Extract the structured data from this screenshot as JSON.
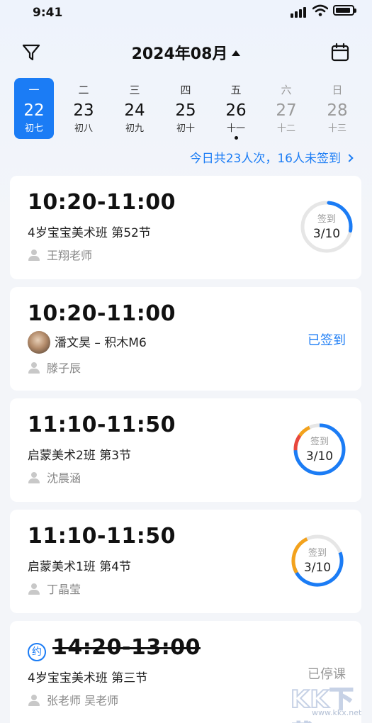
{
  "status_bar": {
    "time": "9:41"
  },
  "header": {
    "month": "2024年08月",
    "icons": {
      "filter": "filter-icon",
      "calendar": "calendar-icon"
    }
  },
  "week": [
    {
      "weekday": "一",
      "date": "22",
      "lunar": "初七",
      "selected": true
    },
    {
      "weekday": "二",
      "date": "23",
      "lunar": "初八"
    },
    {
      "weekday": "三",
      "date": "24",
      "lunar": "初九"
    },
    {
      "weekday": "四",
      "date": "25",
      "lunar": "初十"
    },
    {
      "weekday": "五",
      "date": "26",
      "lunar": "十一",
      "has_dot": true
    },
    {
      "weekday": "六",
      "date": "27",
      "lunar": "十二",
      "weekend": true
    },
    {
      "weekday": "日",
      "date": "28",
      "lunar": "十三",
      "weekend": true
    }
  ],
  "summary": "今日共23人次，16人未签到",
  "cards": [
    {
      "time": "10:20-11:00",
      "course": "4岁宝宝美术班 第52节",
      "teacher": "王翔老师",
      "ring_label": "签到",
      "ring_count": "3/10"
    },
    {
      "time": "10:20-11:00",
      "student": "潘文昊",
      "course_suffix": " – 积木M6",
      "teacher": "滕子辰",
      "status": "已签到"
    },
    {
      "time": "11:10-11:50",
      "course": "启蒙美术2班 第3节",
      "teacher": "沈晨涵",
      "ring_label": "签到",
      "ring_count": "3/10"
    },
    {
      "time": "11:10-11:50",
      "course": "启蒙美术1班 第4节",
      "teacher": "丁晶莹",
      "ring_label": "签到",
      "ring_count": "3/10"
    },
    {
      "badge": "约",
      "time": "14:20-13:00",
      "course": "4岁宝宝美术班 第三节",
      "teacher": "张老师 吴老师",
      "status": "已停课"
    }
  ],
  "colors": {
    "accent": "#1b7cf5",
    "ring_track": "#e6e6e6",
    "ring_red": "#e8473d",
    "ring_orange": "#f3a21c",
    "muted": "#999999"
  },
  "watermark": {
    "text": "KK下载",
    "url": "www.kkx.net"
  }
}
